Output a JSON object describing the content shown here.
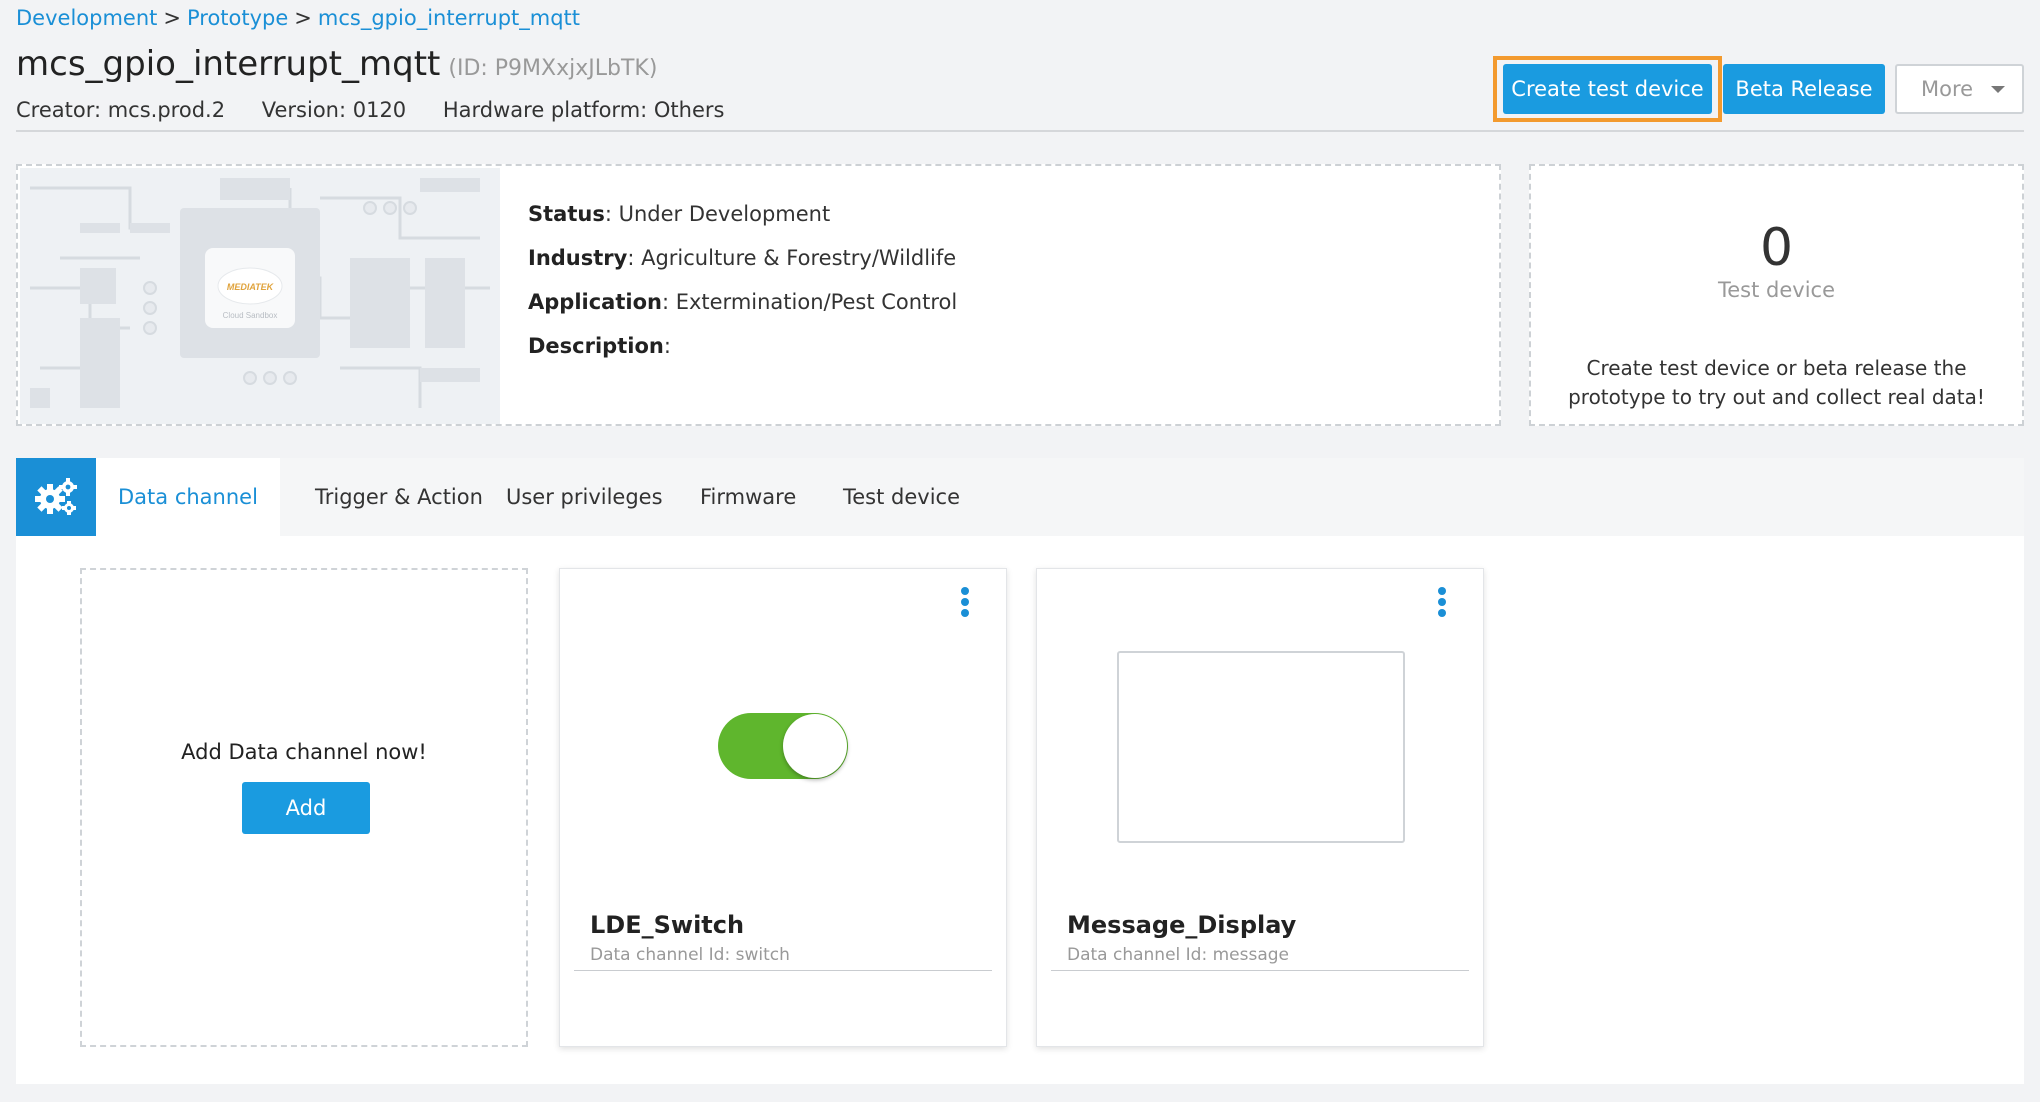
{
  "breadcrumb": {
    "items": [
      "Development",
      "Prototype",
      "mcs_gpio_interrupt_mqtt"
    ],
    "separator": ">"
  },
  "page": {
    "title": "mcs_gpio_interrupt_mqtt",
    "id_text": "(ID: P9MXxjxJLbTK)"
  },
  "meta": {
    "creator": "Creator: mcs.prod.2",
    "version": "Version: 0120",
    "hardware": "Hardware platform: Others"
  },
  "actions": {
    "create_test_device": "Create test device",
    "beta_release": "Beta Release",
    "more": "More"
  },
  "info": {
    "status_label": "Status",
    "status_value": ": Under Development",
    "industry_label": "Industry",
    "industry_value": ": Agriculture & Forestry/Wildlife",
    "application_label": "Application",
    "application_value": ": Extermination/Pest Control",
    "description_label": "Description",
    "description_value": ":",
    "board_brand": "MEDIATEK",
    "board_sub": "Cloud Sandbox"
  },
  "test_device": {
    "count": "0",
    "label": "Test device",
    "description": "Create test device or beta release the prototype to try out and collect real data!"
  },
  "tabs": [
    {
      "label": "Data channel",
      "active": true
    },
    {
      "label": "Trigger & Action",
      "active": false
    },
    {
      "label": "User privileges",
      "active": false
    },
    {
      "label": "Firmware",
      "active": false
    },
    {
      "label": "Test device",
      "active": false
    }
  ],
  "add_card": {
    "text": "Add Data channel now!",
    "button": "Add"
  },
  "channels": [
    {
      "name": "LDE_Switch",
      "id_text": "Data channel Id: switch",
      "widget": "switch",
      "switch_on": true
    },
    {
      "name": "Message_Display",
      "id_text": "Data channel Id: message",
      "widget": "display"
    }
  ],
  "colors": {
    "accent": "#1a8fd6",
    "button": "#1a9be0",
    "focus": "#f39a2e",
    "switch_on": "#5fb62d"
  }
}
